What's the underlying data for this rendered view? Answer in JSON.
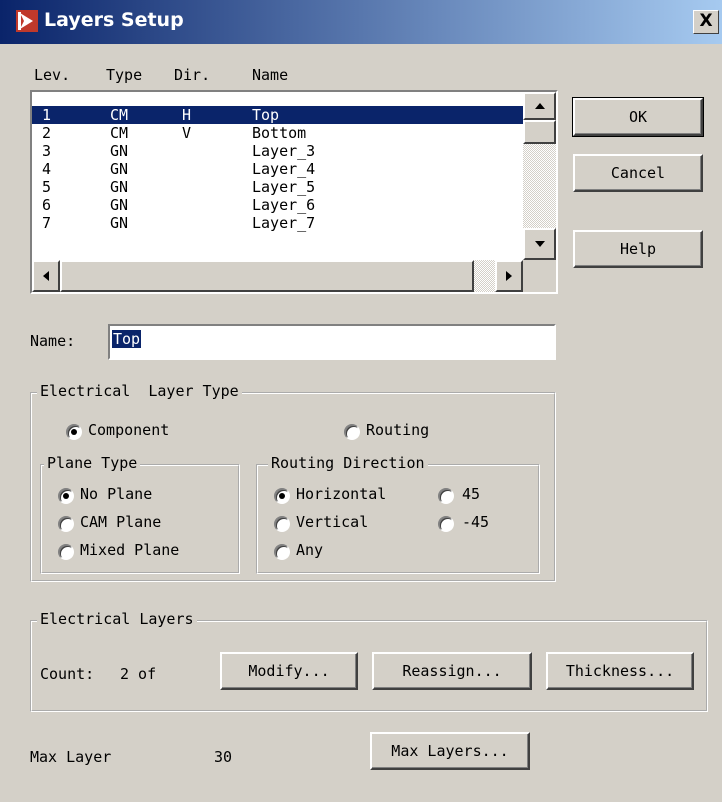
{
  "window": {
    "title": "Layers Setup",
    "close_label": "X"
  },
  "list": {
    "headers": [
      "Lev.",
      "Type",
      "Dir.",
      "Name"
    ],
    "rows": [
      [
        "1",
        "CM",
        "H",
        "Top"
      ],
      [
        "2",
        "CM",
        "V",
        "Bottom"
      ],
      [
        "3",
        "GN",
        "",
        "Layer_3"
      ],
      [
        "4",
        "GN",
        "",
        "Layer_4"
      ],
      [
        "5",
        "GN",
        "",
        "Layer_5"
      ],
      [
        "6",
        "GN",
        "",
        "Layer_6"
      ],
      [
        "7",
        "GN",
        "",
        "Layer_7"
      ]
    ],
    "selected_row": 0
  },
  "buttons": {
    "ok": "OK",
    "cancel": "Cancel",
    "help": "Help"
  },
  "name_field": {
    "label": "Name:",
    "value": "Top"
  },
  "electrical_layer_type": {
    "legend": "Electrical  Layer Type",
    "component": "Component",
    "routing": "Routing",
    "selected": "component"
  },
  "plane_type": {
    "legend": "Plane Type",
    "options": [
      "No Plane",
      "CAM Plane",
      "Mixed Plane"
    ],
    "selected": "No Plane"
  },
  "routing_direction": {
    "legend": "Routing Direction",
    "options": [
      "Horizontal",
      "45",
      "Vertical",
      "-45",
      "Any"
    ],
    "selected": "Horizontal"
  },
  "electrical_layers": {
    "legend": "Electrical Layers",
    "count_label": "Count:",
    "count_value": "2 of",
    "modify": "Modify...",
    "reassign": "Reassign...",
    "thickness": "Thickness..."
  },
  "max_layer": {
    "label": "Max Layer",
    "value": "30",
    "button": "Max Layers..."
  }
}
